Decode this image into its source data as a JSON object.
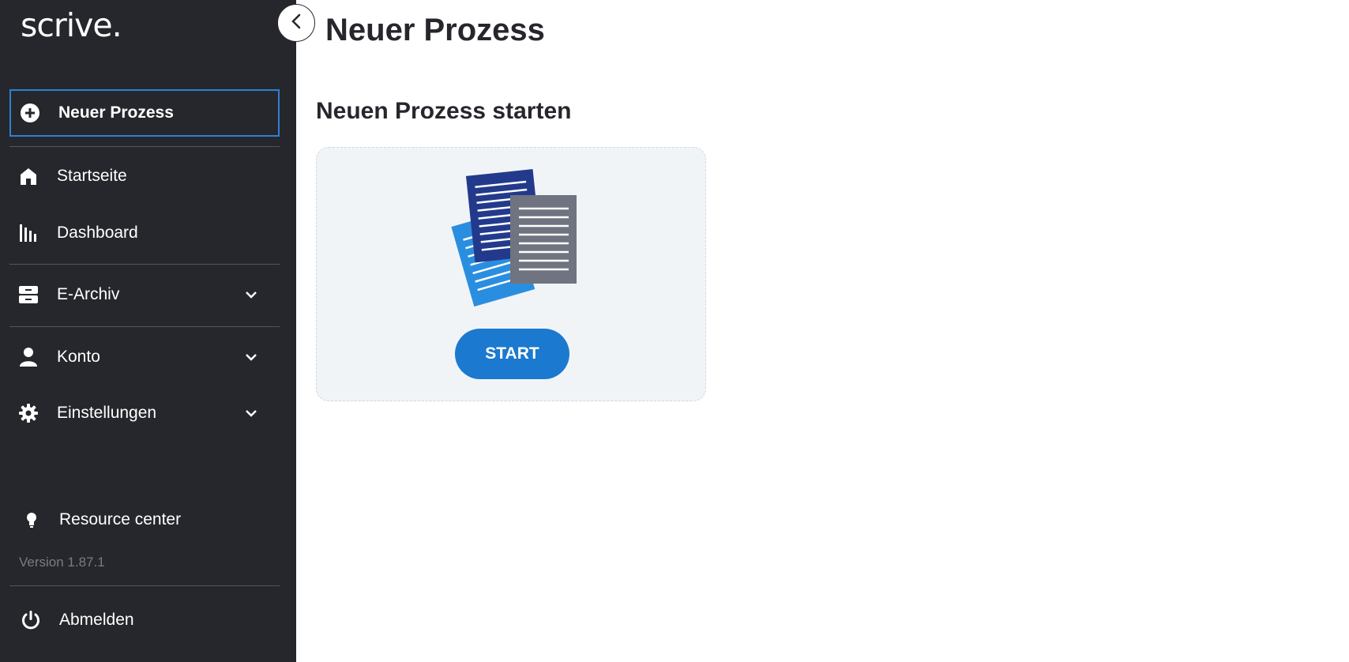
{
  "app": {
    "logo_text": "scrive."
  },
  "sidebar": {
    "items": [
      {
        "label": "Neuer Prozess",
        "icon": "plus-circle-icon",
        "active": true
      },
      {
        "label": "Startseite",
        "icon": "home-icon"
      },
      {
        "label": "Dashboard",
        "icon": "bar-chart-icon"
      },
      {
        "label": "E-Archiv",
        "icon": "archive-icon",
        "expandable": true
      },
      {
        "label": "Konto",
        "icon": "user-icon",
        "expandable": true
      },
      {
        "label": "Einstellungen",
        "icon": "gear-icon",
        "expandable": true
      }
    ],
    "resource_center": {
      "label": "Resource center",
      "icon": "lightbulb-icon"
    },
    "version": "Version 1.87.1",
    "logout": {
      "label": "Abmelden",
      "icon": "power-icon"
    }
  },
  "main": {
    "title": "Neuer Prozess",
    "section_title": "Neuen Prozess starten",
    "start_button": "START"
  },
  "colors": {
    "sidebar_bg": "#26272c",
    "accent": "#1b79d0",
    "active_border": "#2f7fd6",
    "card_bg": "#f1f4f7"
  }
}
